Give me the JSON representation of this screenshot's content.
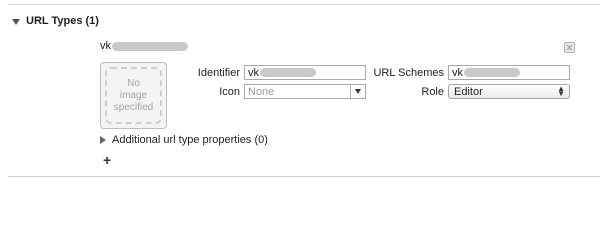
{
  "section": {
    "title": "URL Types (1)"
  },
  "entry": {
    "name": "vk",
    "image_placeholder": [
      "No",
      "image",
      "specified"
    ],
    "identifier_label": "Identifier",
    "identifier_value": "vk",
    "icon_label": "Icon",
    "icon_placeholder": "None",
    "url_schemes_label": "URL Schemes",
    "url_schemes_value": "vk",
    "role_label": "Role",
    "role_value": "Editor"
  },
  "additional": {
    "label": "Additional url type properties (0)"
  },
  "icons": {
    "disclosure": "disclosure-triangle-icon",
    "delete": "delete-x-icon",
    "combo": "dropdown-arrow-icon",
    "popup": "up-down-arrows-icon",
    "add": "plus-icon"
  }
}
